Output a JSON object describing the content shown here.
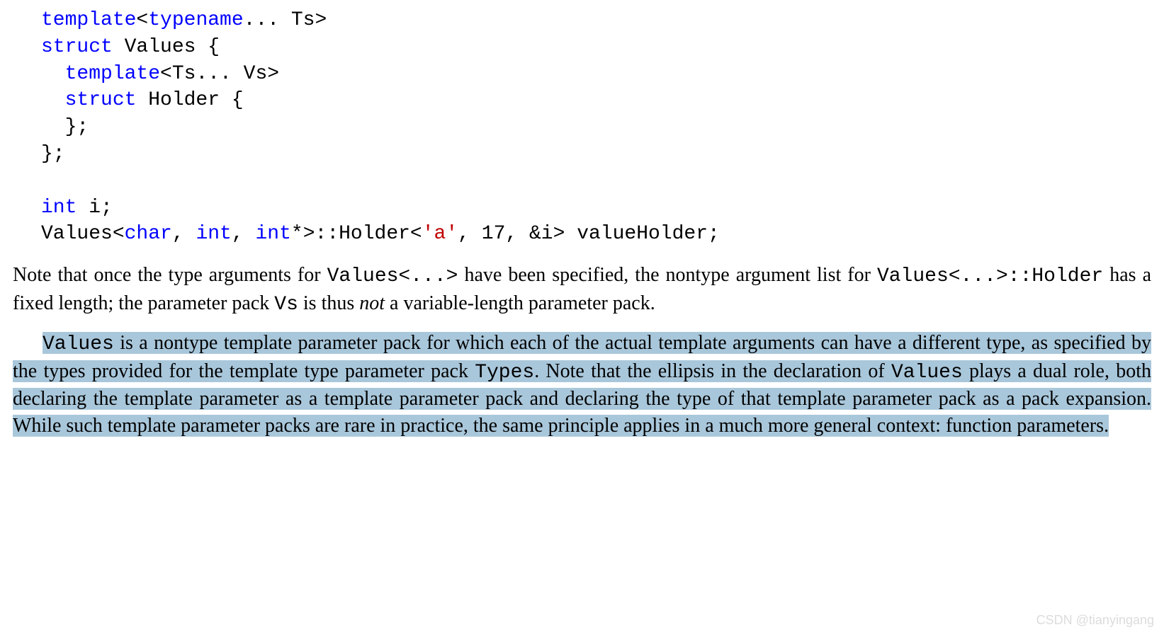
{
  "code": {
    "l1_a": "template",
    "l1_b": "<",
    "l1_c": "typename",
    "l1_d": "... Ts>",
    "l2_a": "struct",
    "l2_b": " Values {",
    "l3_a": "  template",
    "l3_b": "<Ts... Vs>",
    "l4_a": "  struct",
    "l4_b": " Holder {",
    "l5": "  };",
    "l6": "};",
    "blank": "",
    "l8_a": "int",
    "l8_b": " i;",
    "l9_a": "Values<",
    "l9_b": "char",
    "l9_c": ", ",
    "l9_d": "int",
    "l9_e": ", ",
    "l9_f": "int",
    "l9_g": "*>::Holder<",
    "l9_h": "'a'",
    "l9_i": ", 17, &i> valueHolder;"
  },
  "para1": {
    "t1": "Note that once the type arguments for ",
    "c1": "Values<...>",
    "t2": " have been specified, the nontype argument list for ",
    "c2": "Values<...>::Holder",
    "t3": " has a fixed length; the parameter pack ",
    "c3": "Vs",
    "t4": " is thus ",
    "i1": "not",
    "t5": " a variable-length parameter pack."
  },
  "para2": {
    "c1": "Values",
    "t1": " is a nontype template parameter pack for which each of the actual template arguments can have a different type, as specified by the types provided for the template type parameter pack ",
    "c2": "Types",
    "t2": ". Note that the ellipsis in the declaration of ",
    "c3": "Values",
    "t3": " plays a dual role, both declaring the template parameter as a template parameter pack and declaring the type of that template parameter pack as a pack expansion. While such template parameter packs are rare in practice, the same principle applies in a much more general context: function parameters."
  },
  "watermark": "CSDN @tianyingang"
}
